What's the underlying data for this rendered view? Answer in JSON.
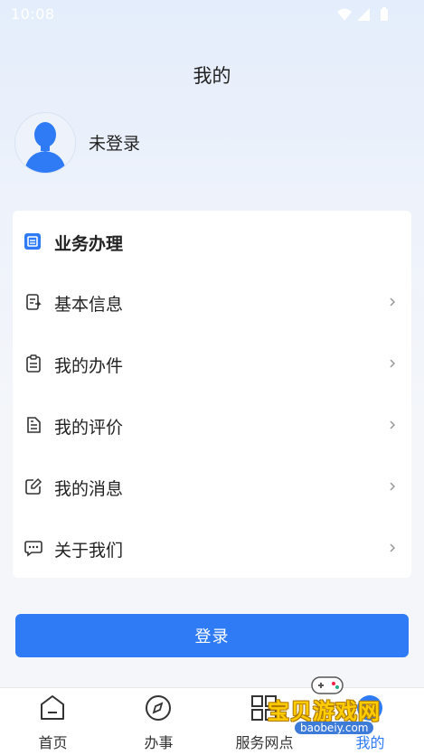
{
  "status_bar": {
    "time": "10:08"
  },
  "page": {
    "title": "我的"
  },
  "profile": {
    "name": "未登录"
  },
  "business": {
    "title": "业务办理",
    "items": [
      {
        "label": "基本信息",
        "icon": "id-card-icon"
      },
      {
        "label": "我的办件",
        "icon": "clipboard-icon"
      },
      {
        "label": "我的评价",
        "icon": "document-icon"
      },
      {
        "label": "我的消息",
        "icon": "edit-icon"
      },
      {
        "label": "关于我们",
        "icon": "chat-icon"
      }
    ]
  },
  "login_button": {
    "label": "登录"
  },
  "tabbar": {
    "tabs": [
      {
        "label": "首页",
        "icon": "home-icon"
      },
      {
        "label": "办事",
        "icon": "compass-icon"
      },
      {
        "label": "服务网点",
        "icon": "grid-icon"
      },
      {
        "label": "我的",
        "icon": "user-icon",
        "active": true
      }
    ]
  },
  "watermark": {
    "text": "宝贝游戏网",
    "url": "baobeiy.com"
  },
  "colors": {
    "accent": "#2f7bf5",
    "background": "#f4f6fa"
  }
}
